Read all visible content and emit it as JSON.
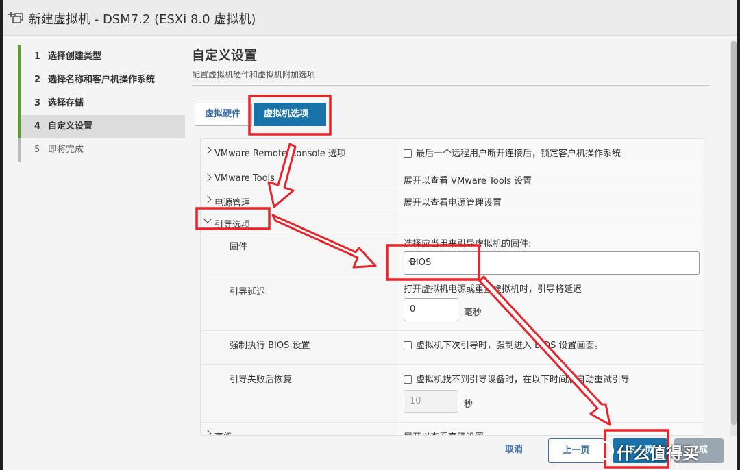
{
  "window": {
    "title": "新建虚拟机 - DSM7.2 (ESXi 8.0 虚拟机)"
  },
  "steps": [
    {
      "num": "1",
      "label": "选择创建类型"
    },
    {
      "num": "2",
      "label": "选择名称和客户机操作系统"
    },
    {
      "num": "3",
      "label": "选择存储"
    },
    {
      "num": "4",
      "label": "自定义设置",
      "active": true
    },
    {
      "num": "5",
      "label": "即将完成"
    }
  ],
  "page": {
    "title": "自定义设置",
    "subtitle": "配置虚拟机硬件和虚拟机附加选项"
  },
  "tabs": [
    {
      "label": "虚拟硬件"
    },
    {
      "label": "虚拟机选项",
      "active": true
    }
  ],
  "rows": {
    "vmrc": {
      "label": "VMware Remote Console 选项",
      "value": "最后一个远程用户断开连接后，锁定客户机操作系统"
    },
    "tools": {
      "label": "VMware Tools",
      "value": "展开以查看 VMware Tools 设置"
    },
    "power": {
      "label": "电源管理",
      "value": "展开以查看电源管理设置"
    },
    "boot": {
      "label": "引导选项"
    },
    "firmware": {
      "label": "固件",
      "hint": "选择应当用来引导虚拟机的固件:",
      "selected": "BIOS"
    },
    "delay": {
      "label": "引导延迟",
      "hint": "打开虚拟机电源或重置虚拟机时，引导将延迟",
      "value": "0",
      "unit": "毫秒"
    },
    "force_bios": {
      "label": "强制执行 BIOS 设置",
      "value": "虚拟机下次引导时，强制进入 BIOS 设置画面。"
    },
    "recovery": {
      "label": "引导失败后恢复",
      "value": "虚拟机找不到引导设备时，在以下时间后自动重试引导",
      "seconds": "10",
      "unit": "秒"
    },
    "advanced": {
      "label": "高级",
      "value": "展开以查看高级设置"
    }
  },
  "footer": {
    "cancel": "取消",
    "prev": "上一页",
    "next": "下一页",
    "finish": "完成"
  },
  "watermark": {
    "text": "什么值得买"
  },
  "colors": {
    "accent": "#1a73a8",
    "step_done": "#5f9b32",
    "annotation": "#e8232a"
  }
}
